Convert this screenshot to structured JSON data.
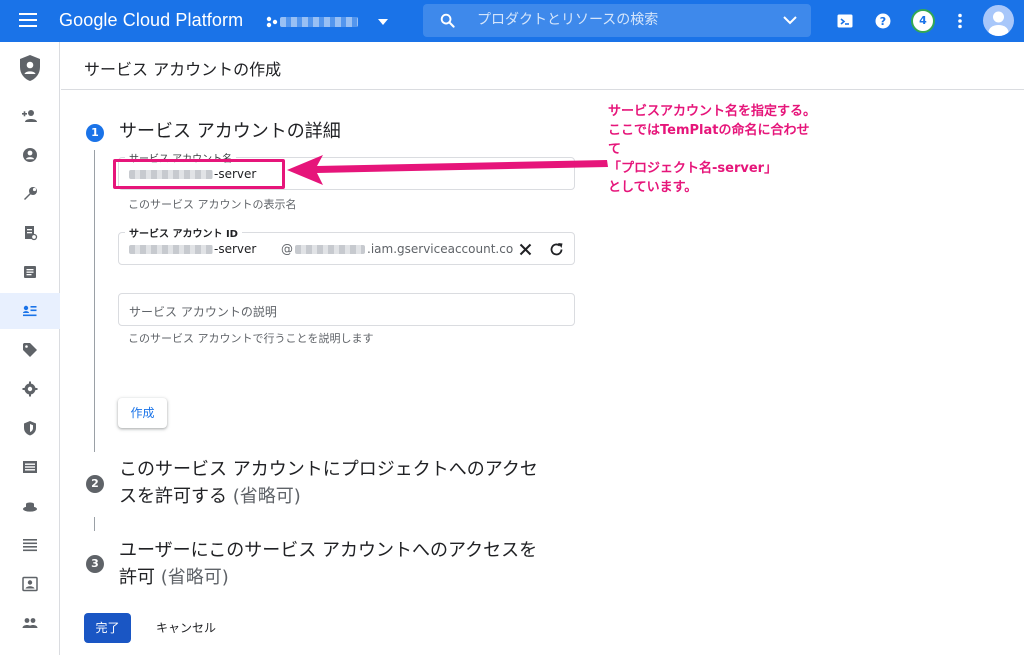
{
  "topbar": {
    "brand": "Google Cloud Platform",
    "search_placeholder": "プロダクトとリソースの検索",
    "notification_count": "4"
  },
  "header": {
    "title": "サービス アカウントの作成"
  },
  "steps": [
    {
      "number": "1",
      "title": "サービス アカウントの詳細",
      "optional": ""
    },
    {
      "number": "2",
      "title": "このサービス アカウントにプロジェクトへのアクセスを許可する",
      "optional": "(省略可)"
    },
    {
      "number": "3",
      "title": "ユーザーにこのサービス アカウントへのアクセスを許可",
      "optional": "(省略可)"
    }
  ],
  "step2_lines": [
    "このサービス アカウントにプロジェクトへのアクセ",
    "スを許可する"
  ],
  "step3_lines": [
    "ユーザーにこのサービス アカウントへのアクセスを",
    "許可"
  ],
  "form": {
    "name_label": "サービス アカウント名",
    "name_value": "-server",
    "name_hint": "このサービス アカウントの表示名",
    "id_label": "サービス アカウント ID",
    "id_value": "-server",
    "id_domain_prefix": "@",
    "id_domain_suffix": ".iam.gserviceaccount.co",
    "description_placeholder": "サービス アカウントの説明",
    "description_hint": "このサービス アカウントで行うことを説明します",
    "create_button": "作成"
  },
  "footer": {
    "done_button": "完了",
    "cancel_button": "キャンセル"
  },
  "annotation": {
    "lines": [
      "サービスアカウント名を指定する。",
      "ここではTemPlatの命名に合わせ",
      "て",
      "「プロジェクト名-server」",
      "としています。"
    ],
    "color": "#e6157a"
  },
  "colors": {
    "topbar": "#1a73e8",
    "primary_button": "#1a56c4",
    "active_rail": "#e8f0fe"
  },
  "rail_icons": [
    "add-person-icon",
    "account-circle-icon",
    "wrench-icon",
    "policy-doc-icon",
    "article-icon",
    "service-account-icon",
    "tag-icon",
    "gear-icon",
    "shield-icon",
    "list-box-icon",
    "hat-icon",
    "lines-icon",
    "contact-card-icon",
    "group-icon",
    "settings-partial-icon"
  ]
}
